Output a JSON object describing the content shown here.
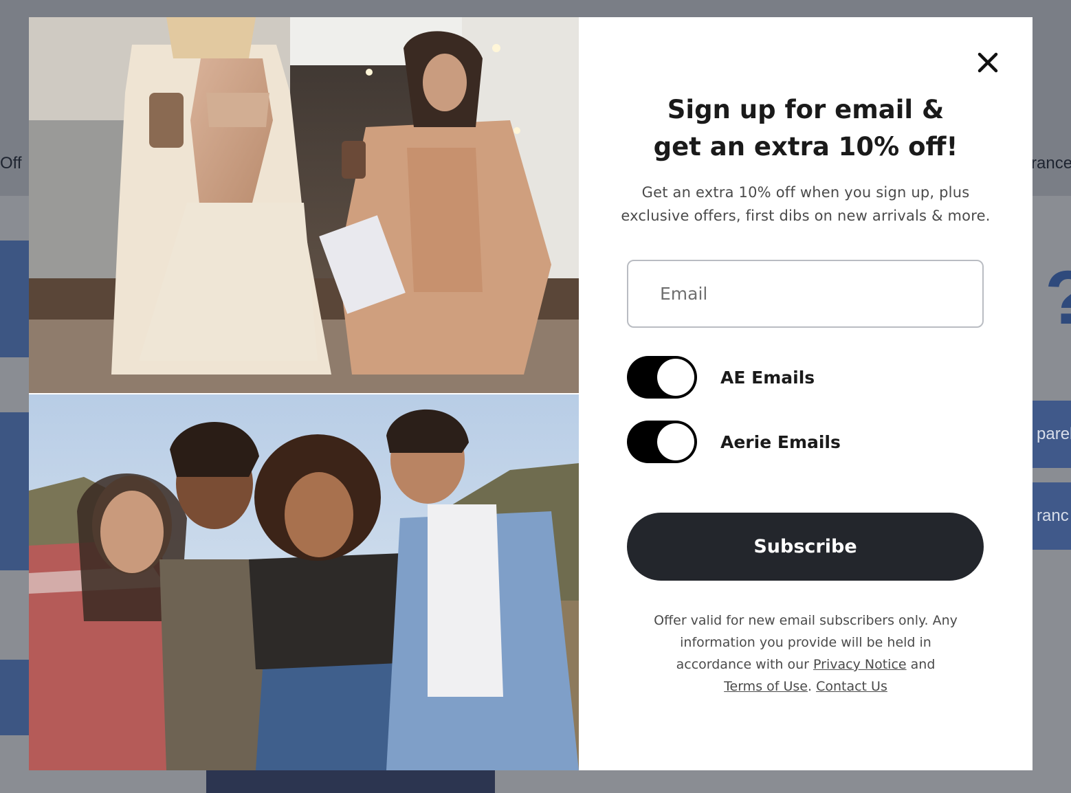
{
  "background": {
    "nav_left_text": "Off",
    "nav_right_text": "rance",
    "side_buttons": [
      "parel",
      "ranc"
    ]
  },
  "modal": {
    "close_icon": "close-icon",
    "headline": {
      "line1": "Sign up for email &",
      "line2": "get an extra 10% off!"
    },
    "subtext": {
      "line1": "Get an extra 10% off when you sign up, plus",
      "line2": "exclusive offers, first dibs on new arrivals & more."
    },
    "email": {
      "placeholder": "Email",
      "value": ""
    },
    "toggles": [
      {
        "label": "AE Emails",
        "on": true
      },
      {
        "label": "Aerie Emails",
        "on": true
      }
    ],
    "subscribe_label": "Subscribe",
    "legal": {
      "line1": "Offer valid for new email subscribers only. Any",
      "line2": "information you provide will be held in",
      "line3_prefix": "accordance with our",
      "privacy_link": "Privacy Notice",
      "line3_suffix": "and",
      "terms_link": "Terms of Use",
      "separator": ".",
      "contact_link": "Contact Us"
    },
    "colors": {
      "toggle_on": "#000000",
      "button_bg": "#23262c",
      "overlay": "#6b7079"
    }
  }
}
